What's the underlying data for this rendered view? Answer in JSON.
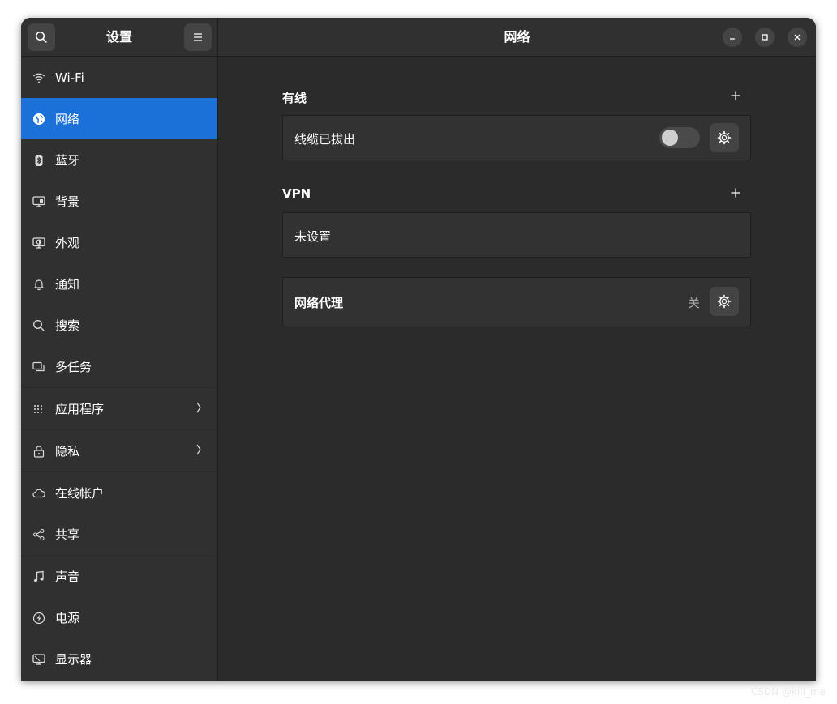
{
  "sidebar": {
    "title": "设置",
    "search_icon": "search-icon",
    "menu_icon": "hamburger-menu-icon",
    "items": [
      {
        "label": "Wi-Fi",
        "icon": "wifi-icon"
      },
      {
        "label": "网络",
        "icon": "globe-icon",
        "active": true
      },
      {
        "label": "蓝牙",
        "icon": "bluetooth-icon"
      },
      {
        "label": "背景",
        "icon": "monitor-image-icon"
      },
      {
        "label": "外观",
        "icon": "display-appearance-icon"
      },
      {
        "label": "通知",
        "icon": "bell-icon"
      },
      {
        "label": "搜索",
        "icon": "search-icon"
      },
      {
        "label": "多任务",
        "icon": "windows-icon"
      },
      {
        "label": "应用程序",
        "icon": "apps-grid-icon"
      },
      {
        "label": "隐私",
        "icon": "lock-icon"
      },
      {
        "label": "在线帐户",
        "icon": "cloud-icon"
      },
      {
        "label": "共享",
        "icon": "share-icon"
      },
      {
        "label": "声音",
        "icon": "music-note-icon"
      },
      {
        "label": "电源",
        "icon": "power-icon"
      },
      {
        "label": "显示器",
        "icon": "display-icon"
      }
    ]
  },
  "header": {
    "title": "网络"
  },
  "wired": {
    "title": "有线",
    "status": "线缆已拔出",
    "toggle_on": false
  },
  "vpn": {
    "title": "VPN",
    "status": "未设置"
  },
  "proxy": {
    "label": "网络代理",
    "state": "关"
  },
  "watermark": "CSDN @kill_me",
  "colors": {
    "accent": "#1c71d8",
    "window_bg": "#2b2b2b",
    "sidebar_bg": "#303030",
    "card_bg": "#323232"
  }
}
